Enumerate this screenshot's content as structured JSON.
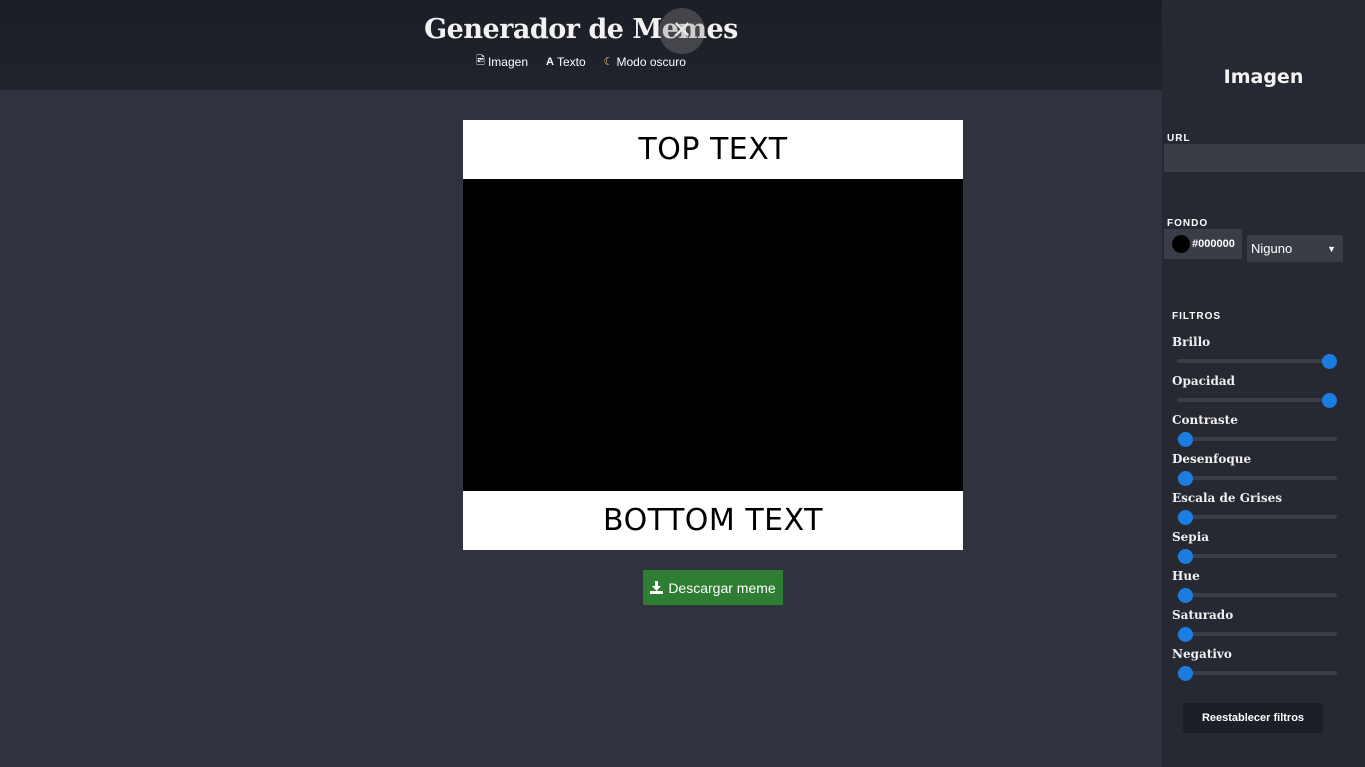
{
  "header": {
    "title": "Generador de Memes",
    "close_glyph": "✕",
    "nav": [
      {
        "label": "Imagen",
        "icon": "image-file-icon",
        "glyph": "🖻"
      },
      {
        "label": "Texto",
        "icon": "text-icon",
        "glyph": "A"
      },
      {
        "label": "Modo oscuro",
        "icon": "moon-icon",
        "glyph": "☾"
      }
    ]
  },
  "meme": {
    "top_text": "TOP TEXT",
    "bottom_text": "BOTTOM TEXT",
    "image_background": "#000000"
  },
  "download": {
    "label": "Descargar meme",
    "icon": "download-icon"
  },
  "sidebar": {
    "title": "Imagen",
    "url_label": "URL",
    "url_value": "",
    "background_label": "FONDO",
    "background_color": "#000000",
    "blend_mode": "Niguno",
    "filters_label": "FILTROS",
    "filters": [
      {
        "label": "Brillo",
        "value": 1.0
      },
      {
        "label": "Opacidad",
        "value": 1.0
      },
      {
        "label": "Contraste",
        "value": 0.0
      },
      {
        "label": "Desenfoque",
        "value": 0.0
      },
      {
        "label": "Escala de Grises",
        "value": 0.0
      },
      {
        "label": "Sepia",
        "value": 0.0
      },
      {
        "label": "Hue",
        "value": 0.0
      },
      {
        "label": "Saturado",
        "value": 0.0
      },
      {
        "label": "Negativo",
        "value": 0.0
      }
    ],
    "reset_label": "Reestablecer filtros"
  },
  "colors": {
    "accent": "#1b7ddf",
    "download_button": "#2e7d32",
    "sidebar_bg": "#262931",
    "page_bg": "#30333d"
  }
}
